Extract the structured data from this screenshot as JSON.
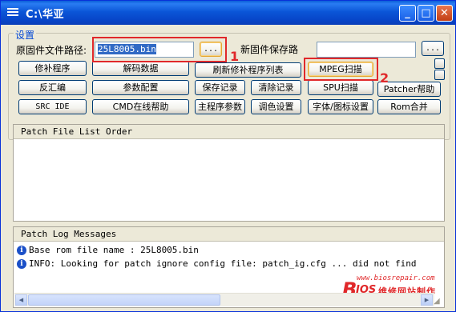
{
  "window": {
    "title": "C:\\华亚"
  },
  "settings": {
    "group_label": "设置",
    "orig_path_label": "原固件文件路径:",
    "orig_path_value": "25L8005.bin",
    "browse_label": "...",
    "new_path_label": "新固件保存路",
    "new_path_value": "",
    "new_browse_label": "..."
  },
  "buttons": {
    "row1": [
      "修补程序",
      "解码数据",
      "刷新修补程序列表",
      "MPEG扫描"
    ],
    "row2": [
      "反汇编",
      "参数配置",
      "保存记录",
      "清除记录",
      "SPU扫描",
      "Patcher帮助"
    ],
    "row3": [
      "SRC IDE",
      "CMD在线帮助",
      "主程序参数",
      "调色设置",
      "字体/图标设置",
      "Rom合并"
    ]
  },
  "annotations": {
    "one": "1",
    "two": "2"
  },
  "patch_list": {
    "header": "Patch File List Order"
  },
  "log": {
    "header": "Patch Log Messages",
    "lines": [
      "Base rom file name : 25L8005.bin",
      "INFO: Looking for patch ignore config file: patch_ig.cfg ... did not find"
    ]
  },
  "watermark": {
    "url": "www.biosrepair.com",
    "brand_b": "B",
    "brand_ios": "IOS",
    "brand_cn": "维修网站制作"
  },
  "icons": {
    "window": "app-menu-icon",
    "info": "info-icon"
  },
  "colors": {
    "title_bar": "#0a56d8",
    "annotation_red": "#e0282a",
    "info_blue": "#1b50c8"
  }
}
